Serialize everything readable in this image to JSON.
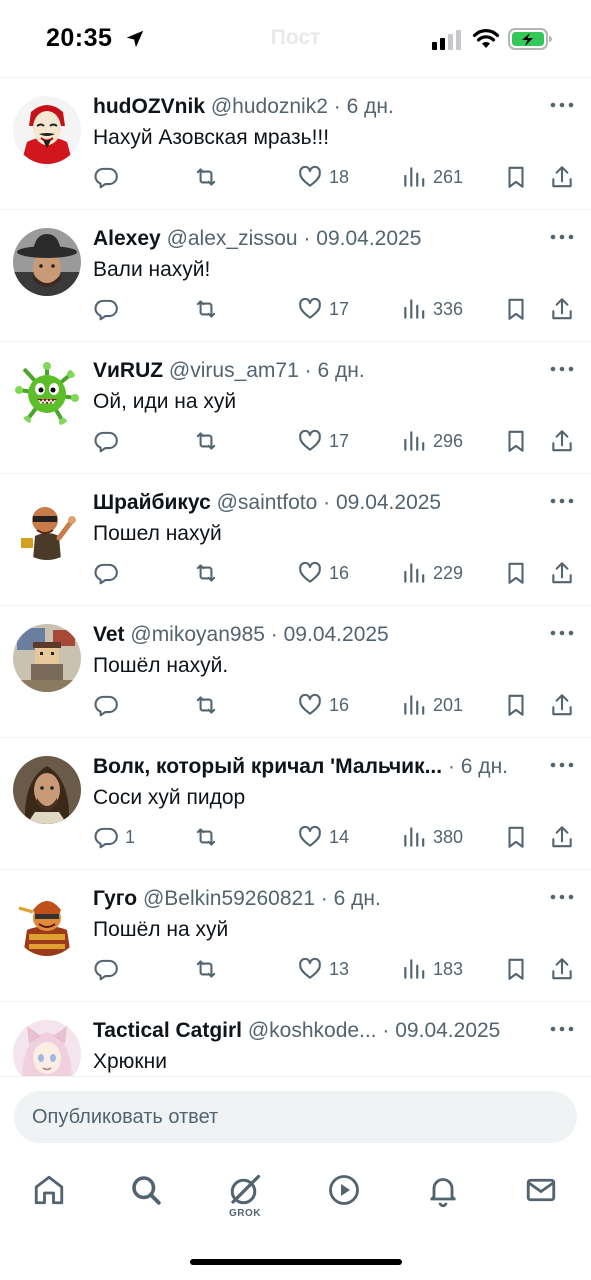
{
  "status_bar": {
    "time": "20:35",
    "title": "Пост"
  },
  "colors": {
    "text": "#0f1419",
    "secondary": "#536471",
    "divider": "#eff3f4",
    "battery": "#34c759"
  },
  "tweets": [
    {
      "name": "hudOZVnik",
      "handle": "@hudoznik2",
      "dot": "·",
      "date": "6 дн.",
      "text": "Нахуй Азовская мразь!!!",
      "replies": "",
      "likes": "18",
      "views": "261",
      "avatar_icon": "money-heist-mask-avatar"
    },
    {
      "name": "Alexey",
      "handle": "@alex_zissou",
      "dot": "·",
      "date": "09.04.2025",
      "text": "Вали нахуй!",
      "replies": "",
      "likes": "17",
      "views": "336",
      "avatar_icon": "cowboy-hat-man-avatar"
    },
    {
      "name": "VиRUZ",
      "handle": "@virus_am71",
      "dot": "·",
      "date": "6 дн.",
      "text": "Ой, иди на хуй",
      "replies": "",
      "likes": "17",
      "views": "296",
      "avatar_icon": "green-virus-avatar"
    },
    {
      "name": "Шрайбикус",
      "handle": "@saintfoto",
      "dot": "·",
      "date": "09.04.2025",
      "text": "Пошел нахуй",
      "replies": "",
      "likes": "16",
      "views": "229",
      "avatar_icon": "cartoon-character-avatar"
    },
    {
      "name": "Vet",
      "handle": "@mikoyan985",
      "dot": "·",
      "date": "09.04.2025",
      "text": "Пошёл нахуй.",
      "replies": "",
      "likes": "16",
      "views": "201",
      "avatar_icon": "pixel-art-avatar"
    },
    {
      "name": "Волк, который кричал 'Мальчик...",
      "handle": "",
      "dot": "·",
      "date": "6 дн.",
      "text": "Соси хуй пидор",
      "replies": "1",
      "likes": "14",
      "views": "380",
      "avatar_icon": "long-haired-man-avatar"
    },
    {
      "name": "Гуго",
      "handle": "@Belkin59260821",
      "dot": "·",
      "date": "6 дн.",
      "text": "Пошёл на хуй",
      "replies": "",
      "likes": "13",
      "views": "183",
      "avatar_icon": "cartoon-warrior-avatar"
    },
    {
      "name": "Tactical Catgirl",
      "handle": "@koshkode...",
      "dot": "·",
      "date": "09.04.2025",
      "text": "Хрюкни",
      "replies": "",
      "likes": "",
      "views": "",
      "avatar_icon": "anime-catgirl-avatar"
    }
  ],
  "reply_bar": {
    "placeholder": "Опубликовать ответ"
  },
  "bottom_nav": {
    "grok_label": "GROK"
  }
}
